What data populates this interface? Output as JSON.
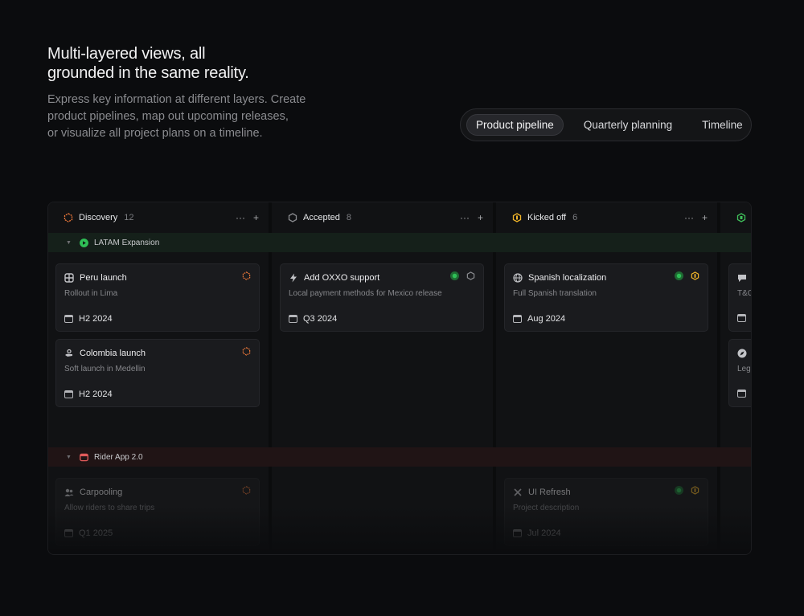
{
  "hero": {
    "title": "Multi-layered views, all\ngrounded in the same reality.",
    "body": "Express key information at different layers. Create\nproduct pipelines, map out upcoming releases,\nor visualize all project plans on a timeline."
  },
  "views": {
    "options": [
      "Product pipeline",
      "Quarterly planning",
      "Timeline"
    ],
    "selected": "Product pipeline"
  },
  "board": {
    "columns": [
      {
        "title": "Discovery",
        "count": "12",
        "color": "#f07a3a",
        "icon": "hexagon-dashed-icon"
      },
      {
        "title": "Accepted",
        "count": "8",
        "color": "#8a8b8f",
        "icon": "hexagon-outline-icon"
      },
      {
        "title": "Kicked off",
        "count": "6",
        "color": "#f0b429",
        "icon": "hexagon-half-icon"
      },
      {
        "title": "",
        "count": "",
        "color": "#3fbf5a",
        "icon": "hexagon-filled-icon"
      }
    ],
    "column_actions": {
      "more": "···",
      "add": "+"
    },
    "groups": [
      {
        "name": "LATAM Expansion",
        "color": "#2fbf56",
        "icon": "play-circle-icon"
      },
      {
        "name": "Rider App 2.0",
        "color": "#e05a5a",
        "icon": "window-icon"
      }
    ],
    "cards": {
      "peru": {
        "title": "Peru launch",
        "desc": "Rollout in Lima",
        "date": "H2 2024",
        "icon": "grid-icon",
        "status": "discovery"
      },
      "colombia": {
        "title": "Colombia launch",
        "desc": "Soft launch in Medellin",
        "date": "H2 2024",
        "icon": "hand-icon",
        "status": "discovery"
      },
      "oxxo": {
        "title": "Add OXXO support",
        "desc": "Local payment methods for Mexico release",
        "date": "Q3 2024",
        "icon": "bolt-icon",
        "status": "accepted"
      },
      "spanish": {
        "title": "Spanish localization",
        "desc": "Full Spanish translation",
        "date": "Aug 2024",
        "icon": "globe-icon",
        "status": "kicked-off"
      },
      "tc": {
        "title": "",
        "desc": "T&C",
        "date": "",
        "icon": "chat-icon"
      },
      "legal": {
        "title": "",
        "desc": "Lega",
        "date": "",
        "icon": "compass-icon"
      },
      "carpooling": {
        "title": "Carpooling",
        "desc": "Allow riders to share trips",
        "date": "Q1 2025",
        "icon": "users-icon",
        "status": "discovery"
      },
      "uirefresh": {
        "title": "UI Refresh",
        "desc": "Project description",
        "date": "Jul 2024",
        "icon": "tools-icon",
        "status": "kicked-off"
      }
    },
    "colors": {
      "accent_green": "#2fbf56",
      "discovery": "#f07a3a",
      "kicked_off": "#f0b429",
      "band_green": "#15201a",
      "band_red": "#201415"
    }
  }
}
